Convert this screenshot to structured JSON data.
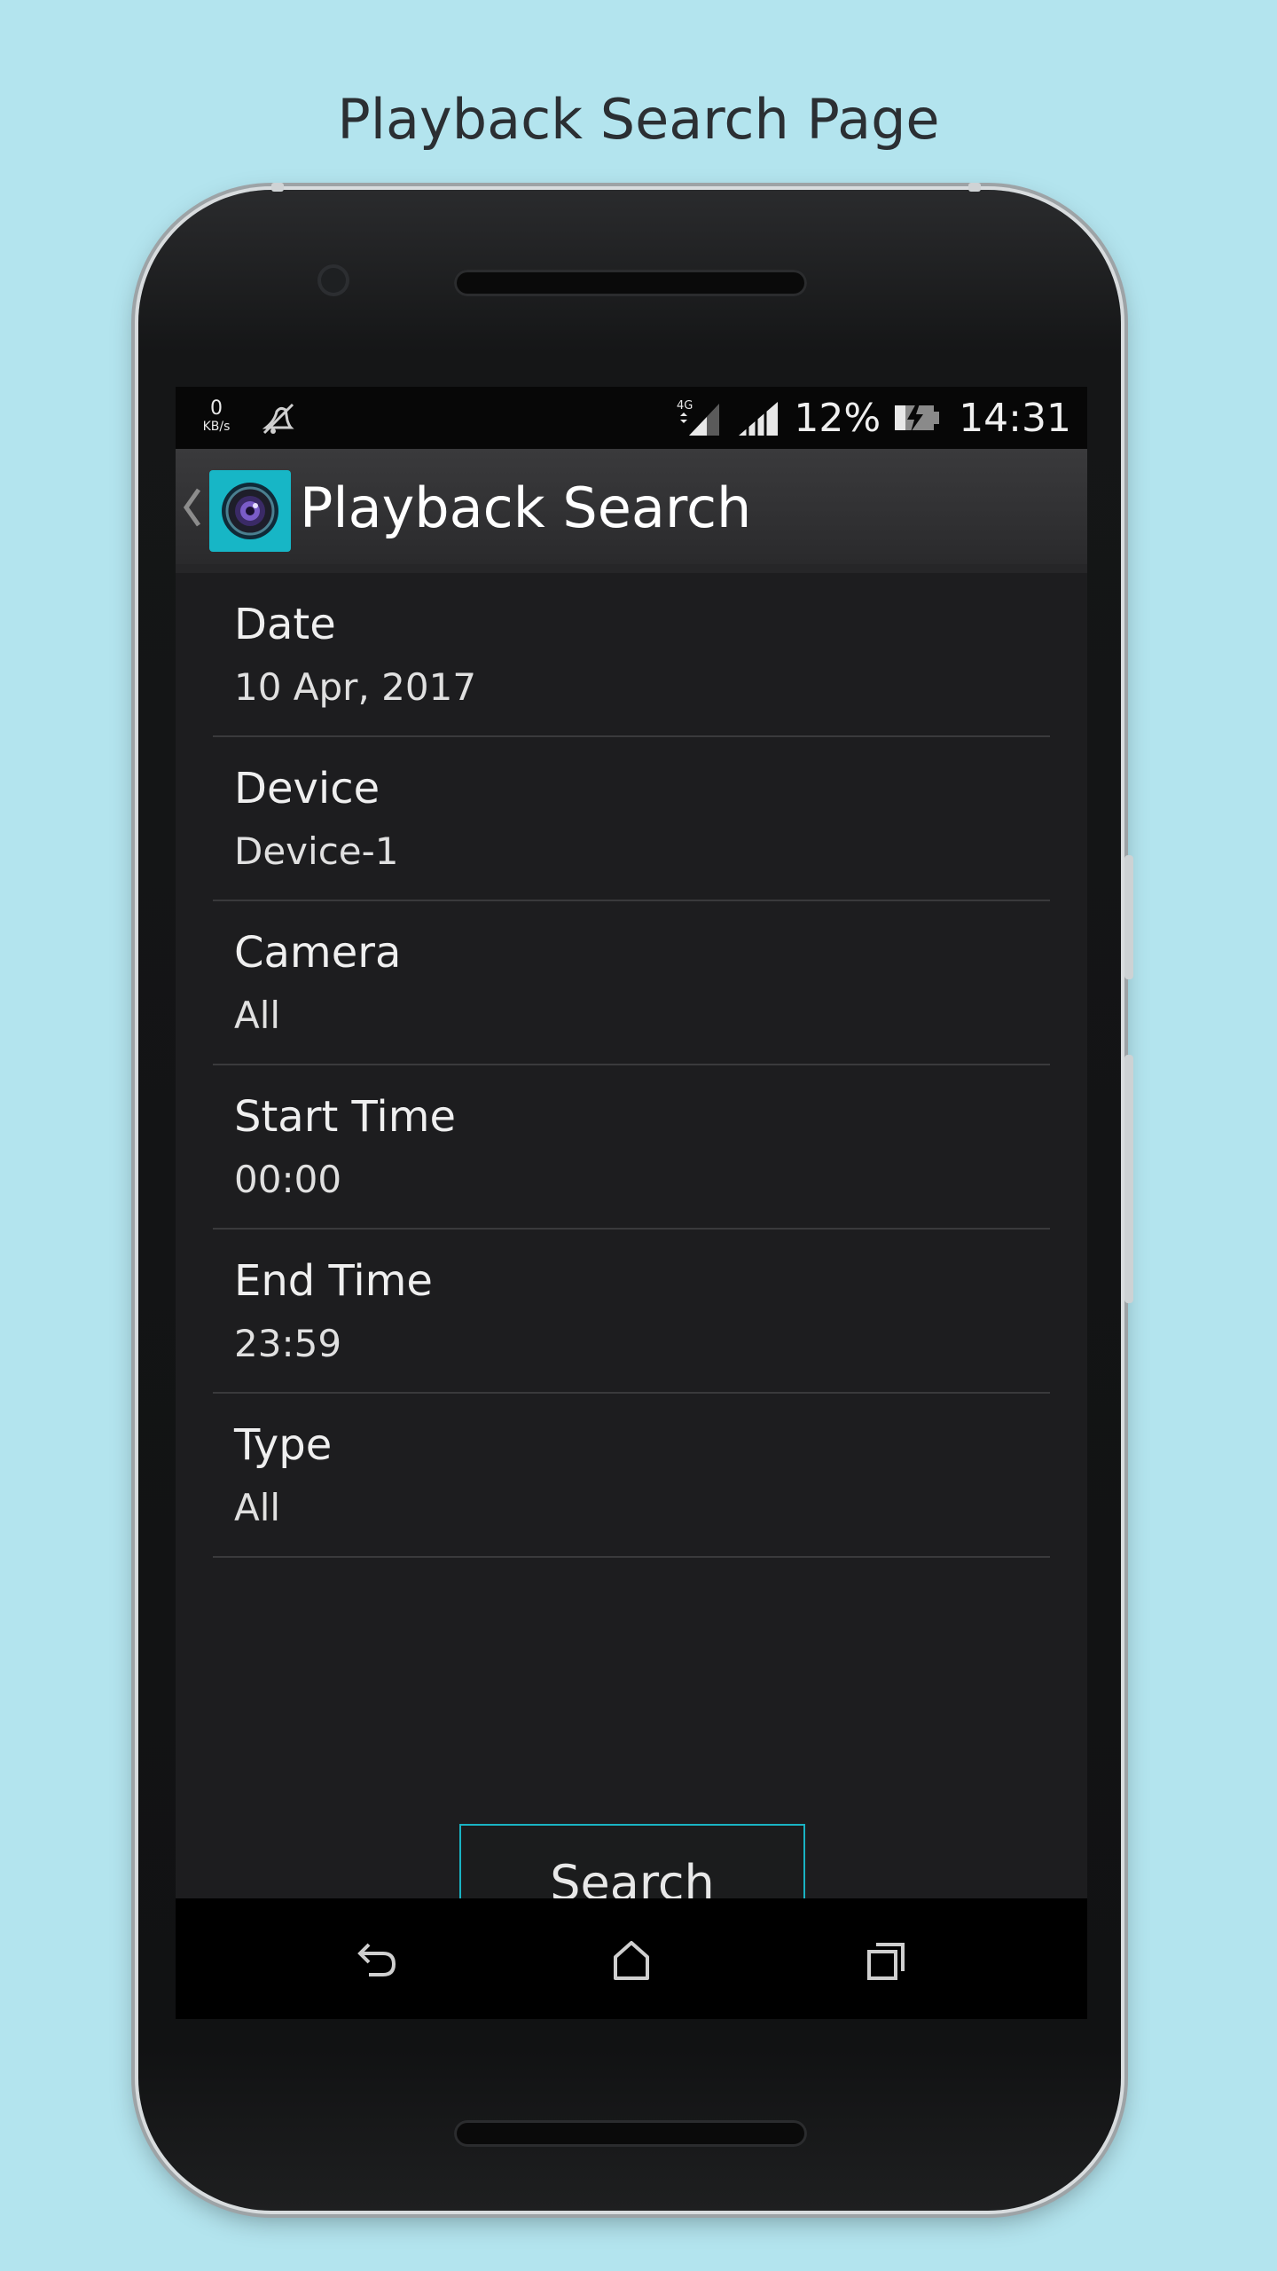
{
  "caption": "Playback Search Page",
  "status_bar": {
    "net_speed_value": "0",
    "net_speed_unit": "KB/s",
    "network_type": "4G",
    "battery_percent": "12%",
    "time": "14:31"
  },
  "app_bar": {
    "title": "Playback Search"
  },
  "fields": [
    {
      "label": "Date",
      "value": "10 Apr, 2017"
    },
    {
      "label": "Device",
      "value": "Device-1"
    },
    {
      "label": "Camera",
      "value": "All"
    },
    {
      "label": "Start Time",
      "value": "00:00"
    },
    {
      "label": "End Time",
      "value": "23:59"
    },
    {
      "label": "Type",
      "value": "All"
    }
  ],
  "search_button": {
    "label": "Search"
  },
  "colors": {
    "background": "#b3e4ee",
    "accent": "#19b3c3",
    "screen": "#1d1d1f"
  },
  "icons": {
    "back": "chevron-left-icon",
    "app": "camera-lens-icon",
    "nav_back": "undo-arrow-icon",
    "nav_home": "home-icon",
    "nav_recents": "recents-icon"
  }
}
